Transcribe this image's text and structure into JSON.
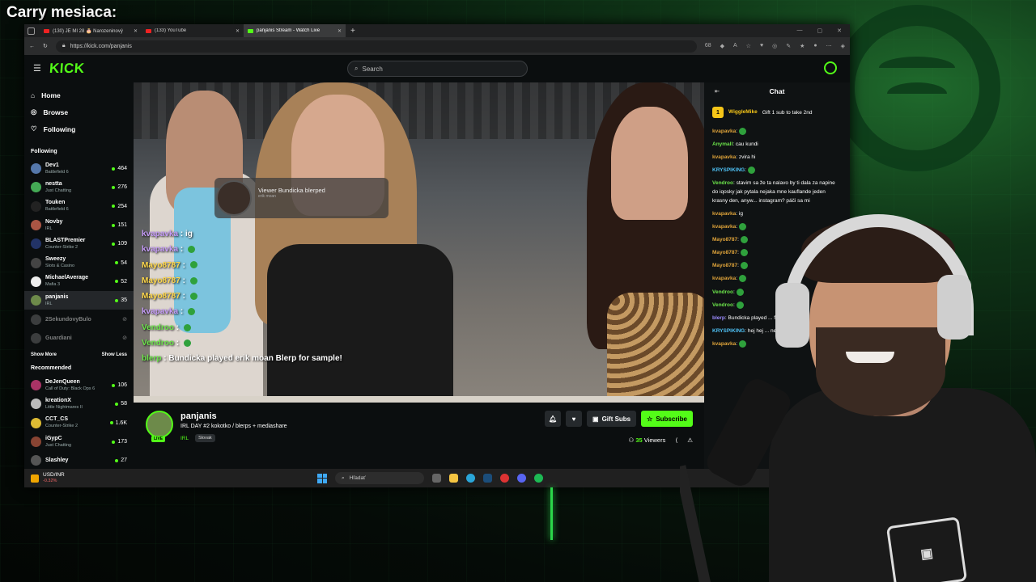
{
  "overlay": {
    "banner": "Carry mesiaca:"
  },
  "browser": {
    "tabs": [
      {
        "label": "(130) JE MI 28 🎂 Narozeninový",
        "favicon": "youtube-icon"
      },
      {
        "label": "(133) YouTube",
        "favicon": "youtube-icon"
      },
      {
        "label": "panjanis Stream - Watch Live",
        "favicon": "kick-icon",
        "active": true
      }
    ],
    "url": "https://kick.com/panjanis",
    "zoom": "68"
  },
  "kick": {
    "logo": "KICK",
    "search_placeholder": "Search",
    "nav": [
      {
        "label": "Home",
        "icon": "home-icon"
      },
      {
        "label": "Browse",
        "icon": "compass-icon"
      },
      {
        "label": "Following",
        "icon": "heart-icon"
      }
    ],
    "following_title": "Following",
    "following": [
      {
        "name": "Dev1",
        "cat": "Battlefield 6",
        "viewers": "464",
        "color": "#5577aa"
      },
      {
        "name": "nestta",
        "cat": "Just Chatting",
        "viewers": "276",
        "color": "#44aa55"
      },
      {
        "name": "Touken",
        "cat": "Battlefield 6",
        "viewers": "254",
        "color": "#222222"
      },
      {
        "name": "Novby",
        "cat": "IRL",
        "viewers": "151",
        "color": "#aa5544"
      },
      {
        "name": "BLASTPremier",
        "cat": "Counter-Strike 2",
        "viewers": "109",
        "color": "#223366"
      },
      {
        "name": "Sweezy",
        "cat": "Slots & Casino",
        "viewers": "54",
        "color": "#444444"
      },
      {
        "name": "MichaelAverage",
        "cat": "Mafia 3",
        "viewers": "52",
        "color": "#eeeeee"
      },
      {
        "name": "panjanis",
        "cat": "IRL",
        "viewers": "35",
        "color": "#6d8a4a",
        "selected": true
      },
      {
        "name": "2SekundovyBulo",
        "cat": "",
        "viewers": "",
        "color": "#777777",
        "offline": true
      },
      {
        "name": "Guardiani",
        "cat": "",
        "viewers": "",
        "color": "#777777",
        "offline": true
      }
    ],
    "show_more": "Show More",
    "show_less": "Show Less",
    "recommended_title": "Recommended",
    "recommended": [
      {
        "name": "DeJenQueen",
        "cat": "Call of Duty: Black Ops 6",
        "viewers": "106",
        "color": "#aa3366"
      },
      {
        "name": "kreationX",
        "cat": "Little Nightmares II",
        "viewers": "58",
        "color": "#bbbbbb"
      },
      {
        "name": "CCT_CS",
        "cat": "Counter-Strike 2",
        "viewers": "1.6K",
        "color": "#ddbb33"
      },
      {
        "name": "iGypC",
        "cat": "Just Chatting",
        "viewers": "173",
        "color": "#884433"
      },
      {
        "name": "Slashley",
        "cat": "",
        "viewers": "27",
        "color": "#555555"
      }
    ],
    "video": {
      "notification": "Viewer Bundicka blerped",
      "notification_sub": "erik moan",
      "overlay_chat": [
        {
          "user": "kvapavka",
          "text": "ig",
          "cls": "p"
        },
        {
          "user": "kvapavka",
          "text": "",
          "cls": "p"
        },
        {
          "user": "Mayo8787",
          "text": "",
          "cls": "y"
        },
        {
          "user": "Mayo8787",
          "text": "",
          "cls": "y"
        },
        {
          "user": "Mayo8787",
          "text": "",
          "cls": "y"
        },
        {
          "user": "kvapavka",
          "text": "",
          "cls": "p"
        },
        {
          "user": "Vendroo",
          "text": "",
          "cls": "g"
        },
        {
          "user": "Vendroo",
          "text": "",
          "cls": "g"
        },
        {
          "user": "blerp",
          "text": "Bundicka played erik moan Blerp for sample!",
          "cls": "g"
        }
      ]
    },
    "stream": {
      "channel": "panjanis",
      "live": "LIVE",
      "title": "IRL DAY #2 kokotko / blerps + mediashare",
      "category": "IRL",
      "tag": "Slovak",
      "gift_label": "Gift Subs",
      "subscribe_label": "Subscribe",
      "viewers": "35",
      "viewers_label": "Viewers"
    },
    "chat": {
      "title": "Chat",
      "pinned_user": "WiggleMike",
      "pinned_count": "1",
      "pinned_text": "Gift 1 sub to take 2nd",
      "messages": [
        {
          "user": "kvapavka",
          "text": "",
          "cls": "u1"
        },
        {
          "user": "Anymall",
          "text": "cau kundi",
          "cls": "u2"
        },
        {
          "user": "kvapavka",
          "text": "zvira hi",
          "cls": "u1"
        },
        {
          "user": "KRYSPIKING",
          "text": "",
          "cls": "u4"
        },
        {
          "user": "Vendroo",
          "text": "stavim sa že ta nalavo by ti dala za napine do iqosky jak pytala nejaka mne kauflande jeden krasny den, anyw... instagram? páči sa mi",
          "cls": "u2"
        },
        {
          "user": "kvapavka",
          "text": "ig",
          "cls": "u1"
        },
        {
          "user": "kvapavka",
          "text": "",
          "cls": "u1"
        },
        {
          "user": "Mayo8787",
          "text": "",
          "cls": "u1"
        },
        {
          "user": "Mayo8787",
          "text": "",
          "cls": "u1"
        },
        {
          "user": "Mayo8787",
          "text": "",
          "cls": "u1"
        },
        {
          "user": "kvapavka",
          "text": "",
          "cls": "u1"
        },
        {
          "user": "Vendroo",
          "text": "",
          "cls": "u2"
        },
        {
          "user": "Vendroo",
          "text": "",
          "cls": "u2"
        },
        {
          "user": "blerp",
          "text": "Bundicka played ... for sample!",
          "cls": "u3"
        },
        {
          "user": "KRYSPIKING",
          "text": "hej hej ... nepytal Seuro na m...",
          "cls": "u4"
        },
        {
          "user": "kvapavka",
          "text": "",
          "cls": "u1"
        }
      ]
    }
  },
  "taskbar": {
    "ticker": "USD/INR",
    "change": "-0.32%",
    "search": "Hľadať"
  },
  "colors": {
    "accent": "#53fc18",
    "bg": "#0b0e0f"
  }
}
